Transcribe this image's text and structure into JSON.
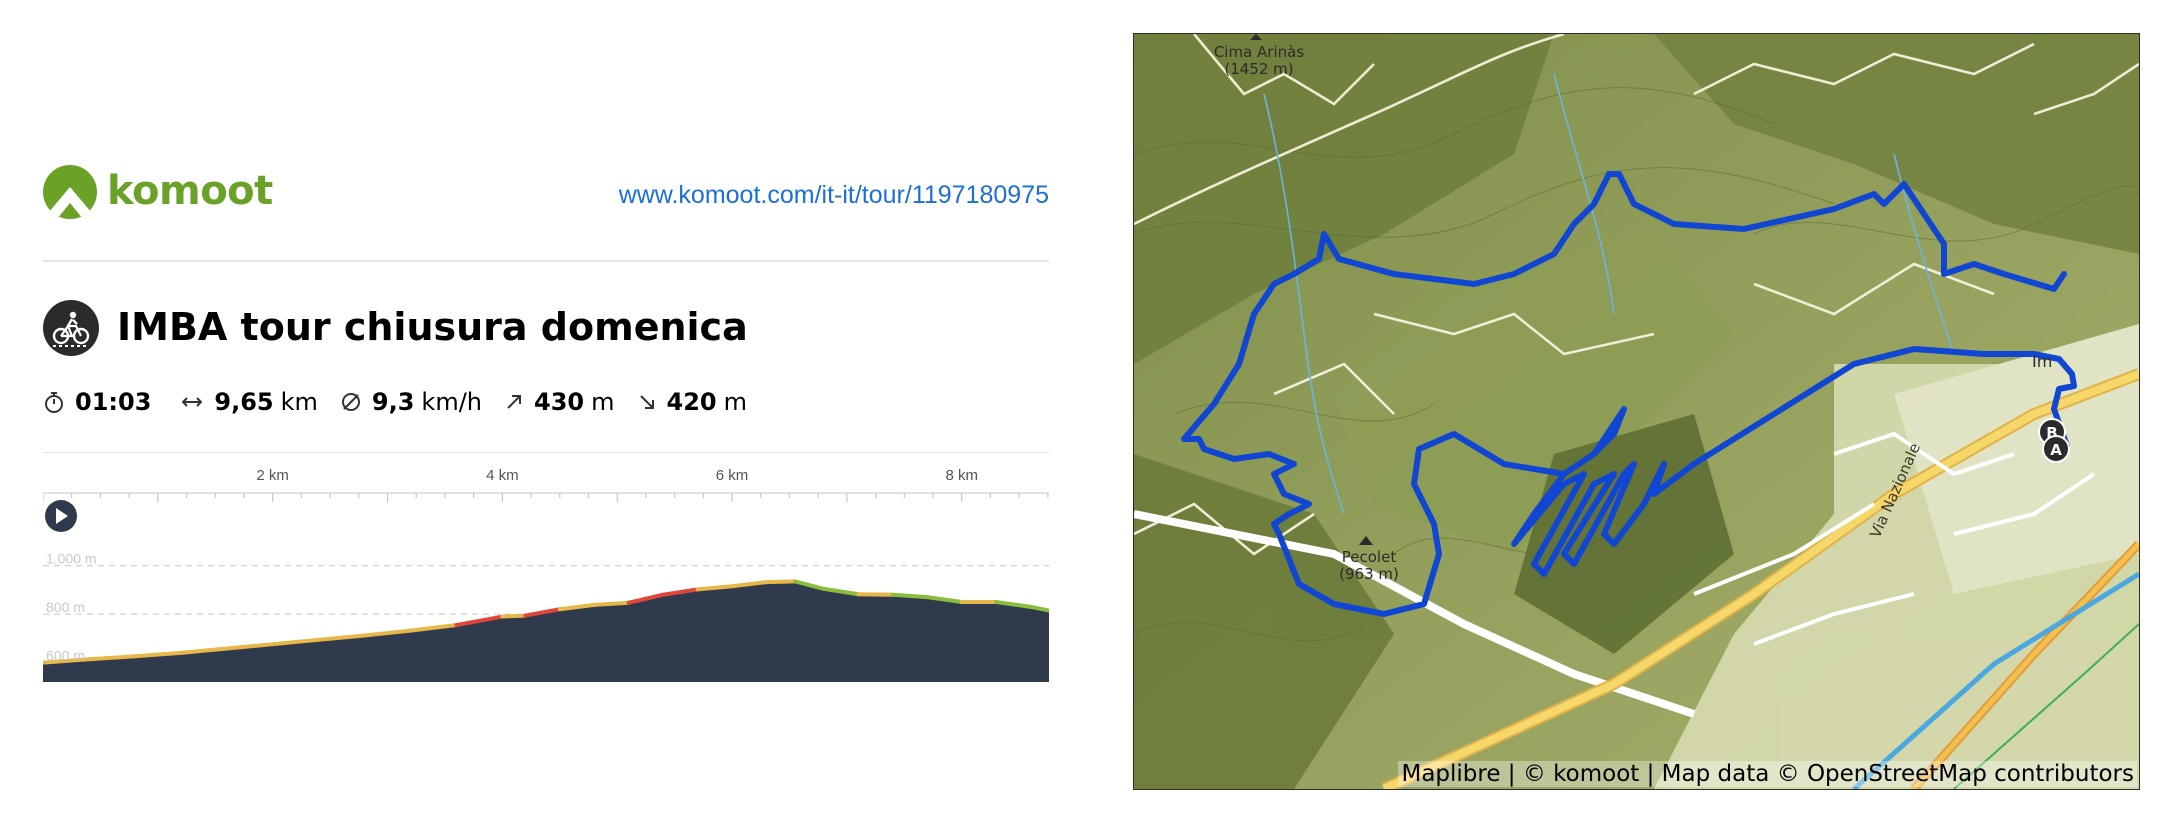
{
  "brand": {
    "name": "komoot"
  },
  "url": "www.komoot.com/it-it/tour/1197180975",
  "tour": {
    "title": "IMBA tour chiusura domenica",
    "sport_icon": "mountain-bike-icon"
  },
  "stats": {
    "duration": "01:03",
    "distance_value": "9,65",
    "distance_unit": "km",
    "speed_value": "9,3",
    "speed_unit": "km/h",
    "uphill_value": "430",
    "uphill_unit": "m",
    "downhill_value": "420",
    "downhill_unit": "m"
  },
  "chart_data": {
    "type": "area",
    "xlabel": "",
    "ylabel": "",
    "x_ticks": [
      "2 km",
      "4 km",
      "6 km",
      "8 km"
    ],
    "y_ticks": [
      "1.000 m",
      "800 m",
      "600 m"
    ],
    "xlim": [
      0,
      8.76
    ],
    "ylim": [
      520,
      1180
    ],
    "x": [
      0,
      0.4,
      0.8,
      1.2,
      1.6,
      2.0,
      2.4,
      2.8,
      3.2,
      3.6,
      4.0,
      4.2,
      4.5,
      4.8,
      5.1,
      5.4,
      5.7,
      6.0,
      6.3,
      6.55,
      6.8,
      7.1,
      7.4,
      7.7,
      8.0,
      8.3,
      8.6,
      8.76
    ],
    "y": [
      600,
      614,
      626,
      640,
      658,
      676,
      694,
      712,
      732,
      755,
      790,
      794,
      820,
      838,
      847,
      880,
      902,
      915,
      932,
      935,
      904,
      882,
      880,
      870,
      850,
      850,
      830,
      815
    ],
    "colors": {
      "fill": "#2f3a4c",
      "line_flat": "#e8b74a",
      "line_steep": "#e0473b",
      "line_down": "#8bbd3c"
    }
  },
  "map": {
    "peaks": [
      {
        "name": "Cima Arinàs",
        "elevation": "(1452 m)"
      },
      {
        "name": "Pecolet",
        "elevation": "(963 m)"
      }
    ],
    "town_label": "Im",
    "road_label": "Via Nazionale",
    "markers": [
      "A",
      "B"
    ],
    "attribution": "Maplibre | © komoot | Map data © OpenStreetMap contributors",
    "colors": {
      "route": "#1046d1",
      "terrain": "#8f9e58",
      "road_major": "#f6d86a",
      "river": "#4aa7e0"
    }
  }
}
